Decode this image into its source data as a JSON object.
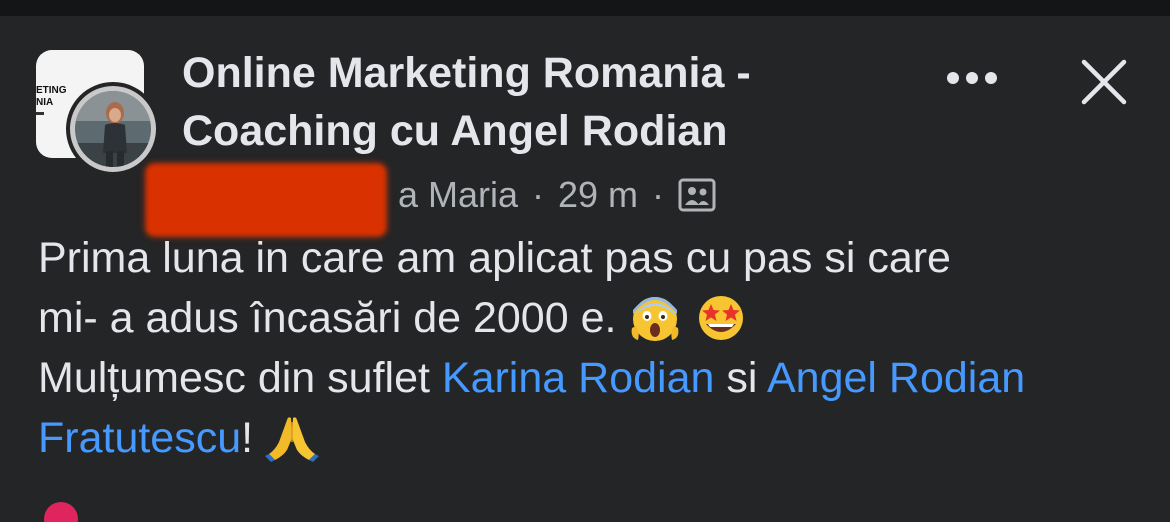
{
  "post": {
    "group_avatar_text": "ETING\nNIA",
    "group_name": "Online Marketing Romania - Coaching cu Angel Rodian",
    "author_visible": "a Maria",
    "separator": "·",
    "time": "29 m",
    "body": {
      "line1": "Prima luna in care am aplicat pas cu pas si care",
      "line2": "mi- a adus încasări de 2000 e.",
      "line3_prefix": "Mulțumesc din suflet ",
      "mention1": "Karina Rodian",
      "connector": " si ",
      "mention2": "Angel Rodian Fratutescu",
      "suffix": "!"
    }
  },
  "icons": {
    "more": "more-options-icon",
    "close": "close-icon",
    "audience": "group-members-icon",
    "emoji1": "face-screaming-in-fear",
    "emoji2": "star-struck",
    "emoji3": "folded-hands"
  },
  "colors": {
    "background": "#242526",
    "text": "#e4e6eb",
    "secondary_text": "#b0b3b8",
    "mention": "#4599ff",
    "redaction": "#d93200"
  }
}
